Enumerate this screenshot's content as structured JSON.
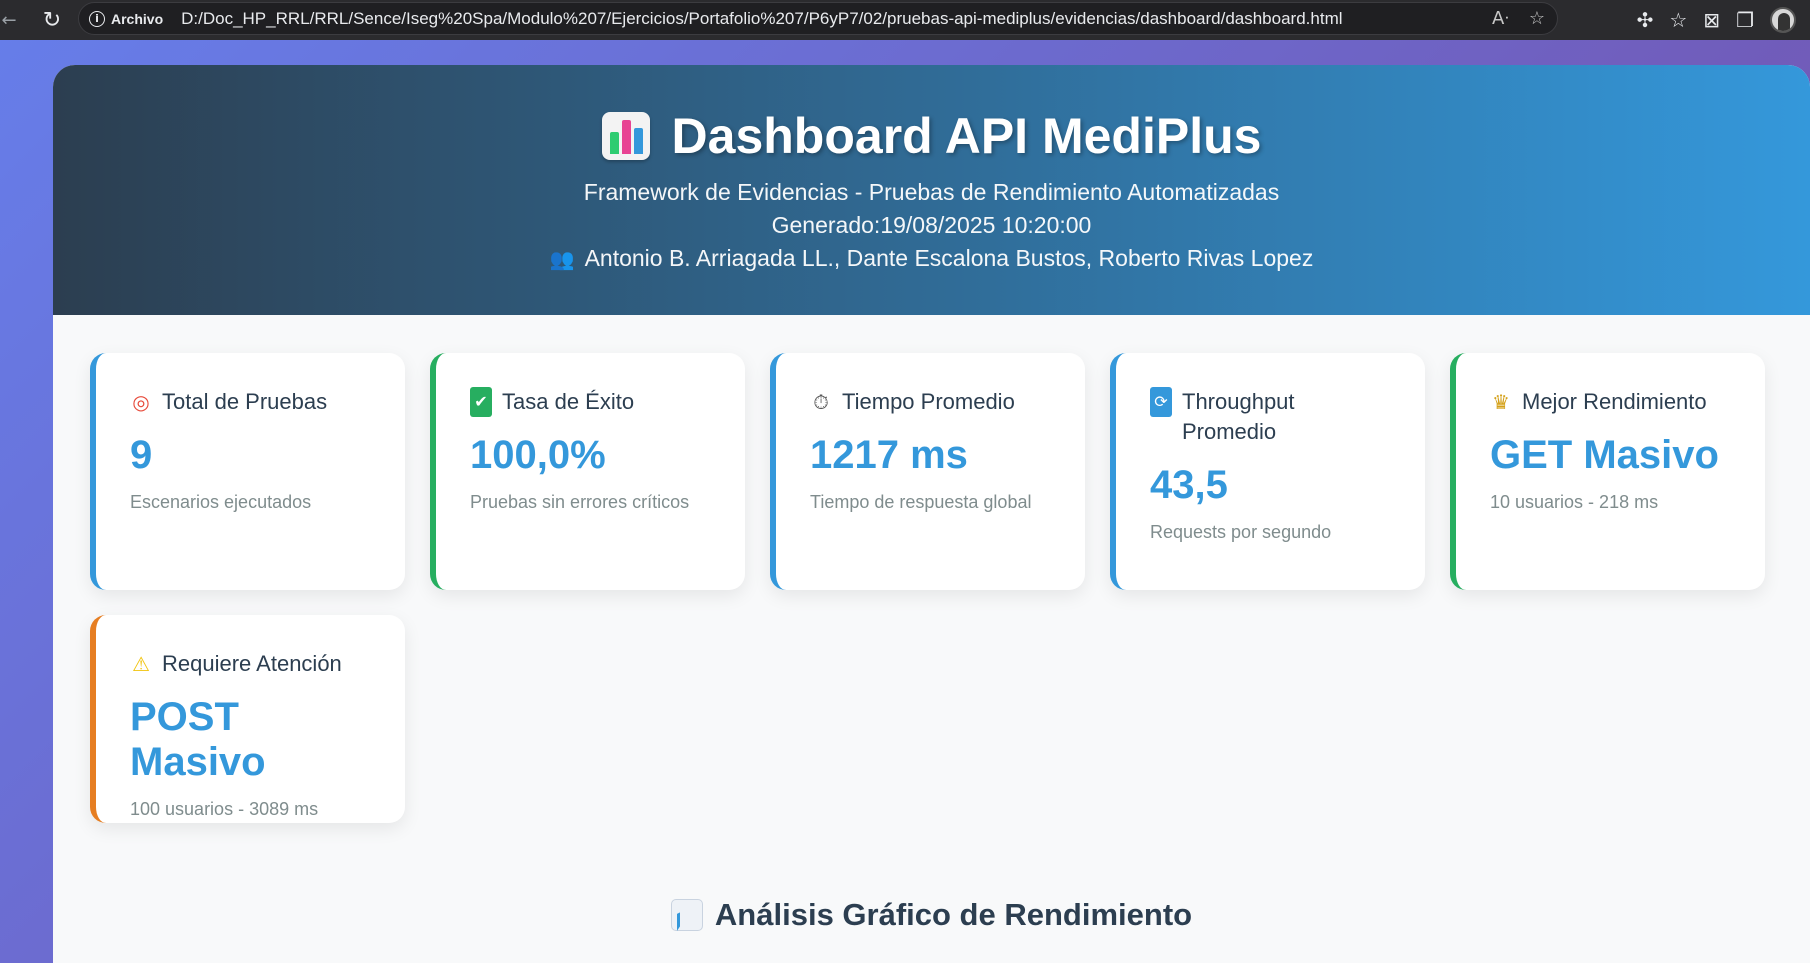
{
  "browser": {
    "back_icon": "arrow-left-icon",
    "reload_icon": "reload-icon",
    "site_label": "Archivo",
    "url": "D:/Doc_HP_RRL/RRL/Sence/Iseg%20Spa/Modulo%207/Ejercicios/Portafolio%207/P6yP7/02/pruebas-api-mediplus/evidencias/dashboard/dashboard.html",
    "read_aloud_icon": "read-aloud-icon",
    "favorite_icon": "star-icon",
    "extensions_icon": "puzzle-icon",
    "favorites_icon": "favorites-list-icon",
    "screenshot_icon": "web-capture-icon",
    "collections_icon": "collections-icon",
    "profile_icon": "avatar"
  },
  "header": {
    "title": "Dashboard API MediPlus",
    "subtitle": "Framework de Evidencias - Pruebas de Rendimiento Automatizadas",
    "generated": "Generado:19/08/2025 10:20:00",
    "authors": "Antonio B. Arriagada LL., Dante Escalona Bustos, Roberto Rivas Lopez"
  },
  "cards": [
    {
      "icon": "target-icon",
      "title": "Total de Pruebas",
      "value": "9",
      "desc": "Escenarios ejecutados",
      "accent": "#3498db"
    },
    {
      "icon": "check-icon",
      "title": "Tasa de Éxito",
      "value": "100,0%",
      "desc": "Pruebas sin errores críticos",
      "accent": "#27ae60"
    },
    {
      "icon": "stopwatch-icon",
      "title": "Tiempo Promedio",
      "value": "1217 ms",
      "desc": "Tiempo de respuesta global",
      "accent": "#3498db"
    },
    {
      "icon": "refresh-icon",
      "title": "Throughput Promedio",
      "value": "43,5",
      "desc": "Requests por segundo",
      "accent": "#3498db"
    },
    {
      "icon": "trophy-icon",
      "title": "Mejor Rendimiento",
      "value": "GET Masivo",
      "desc": "10 usuarios - 218 ms",
      "accent": "#27ae60"
    },
    {
      "icon": "warning-icon",
      "title": "Requiere Atención",
      "value": "POST Masivo",
      "desc": "100 usuarios - 3089 ms",
      "accent": "#e67e22"
    }
  ],
  "section": {
    "title": "Análisis Gráfico de Rendimiento"
  }
}
